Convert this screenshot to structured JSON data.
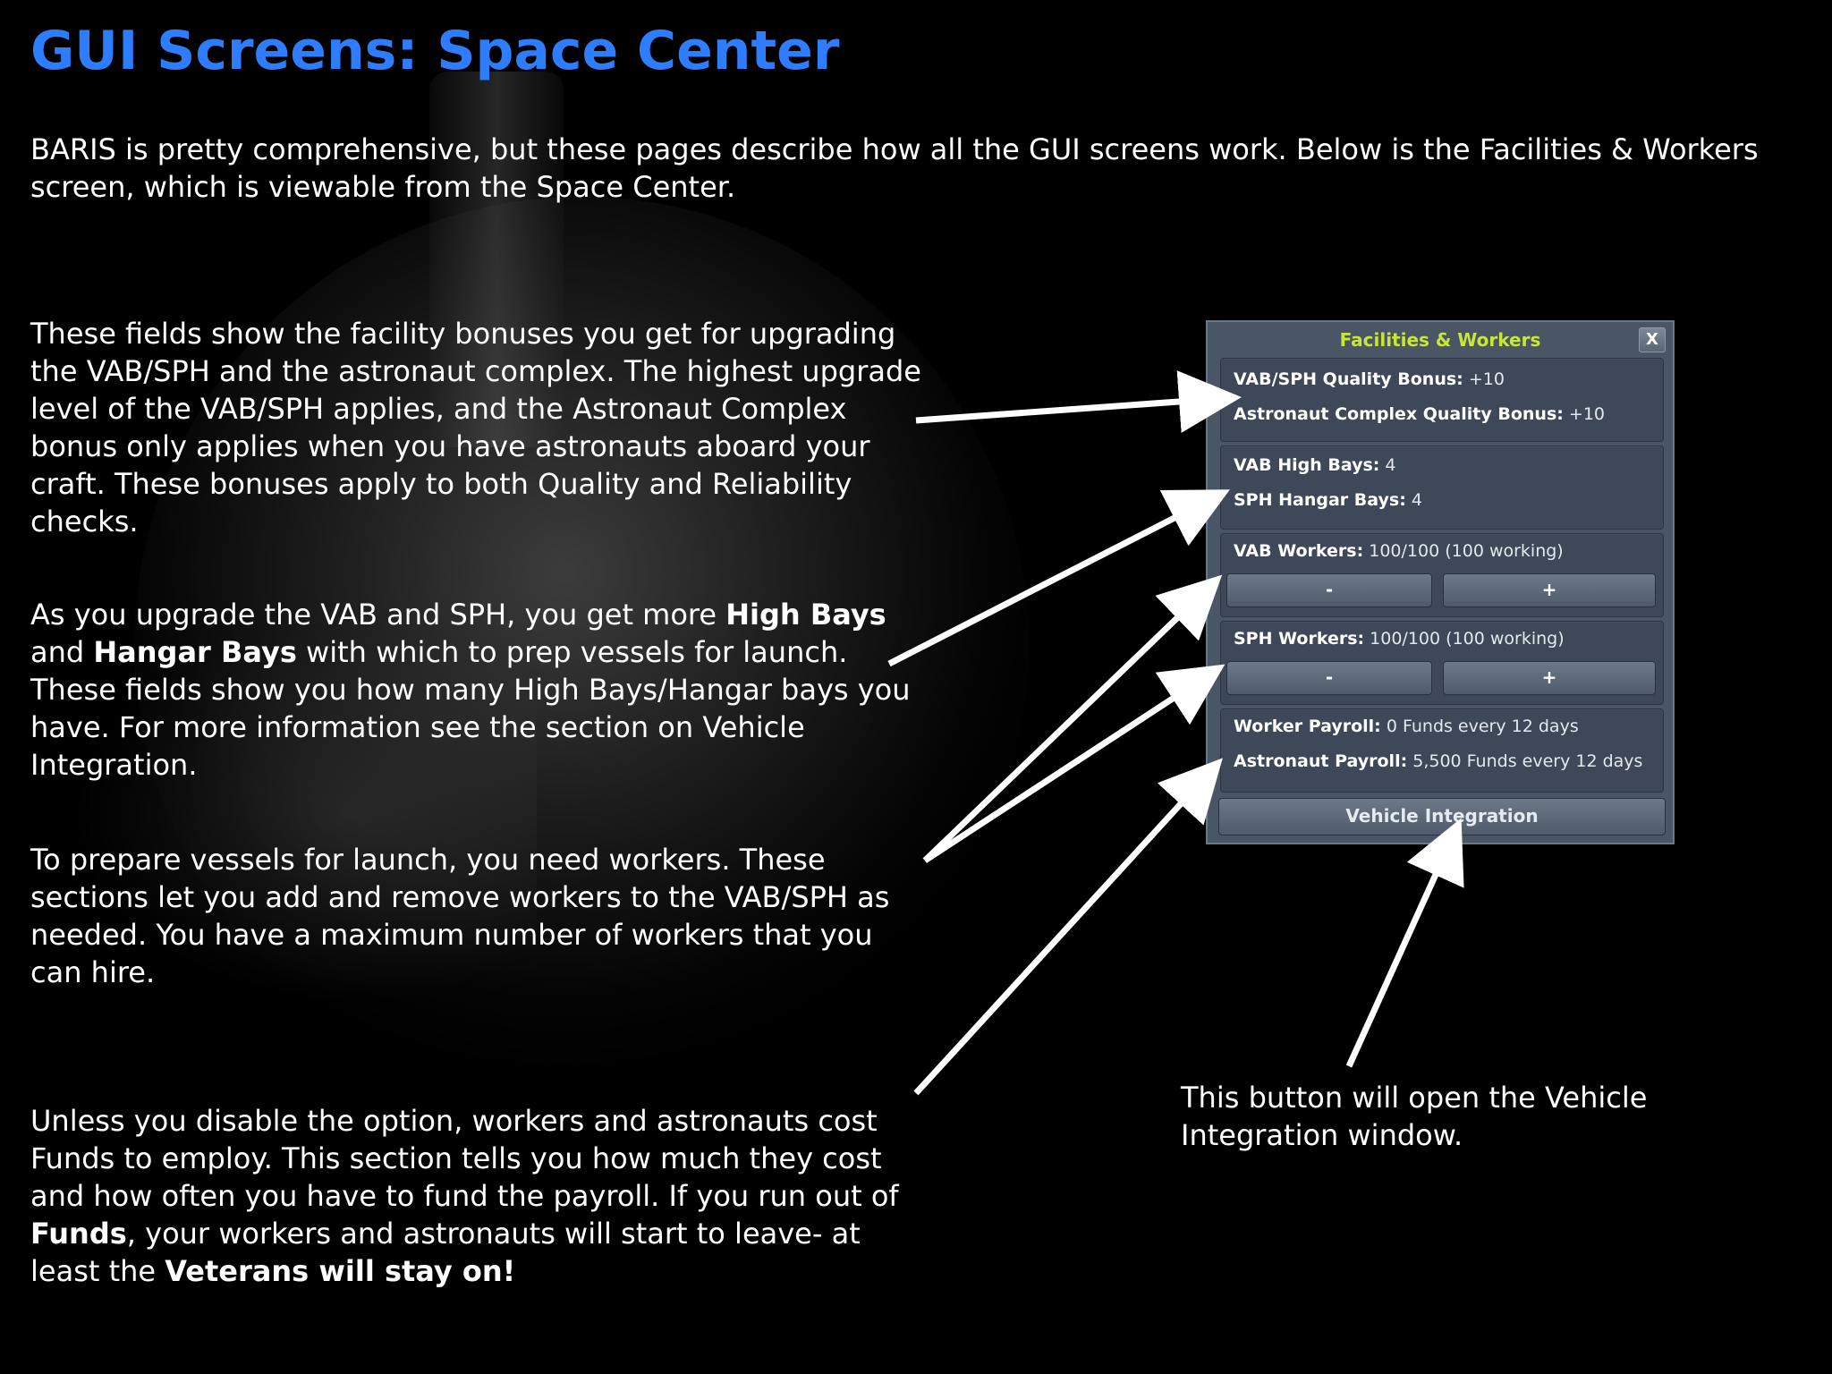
{
  "title": "GUI Screens: Space Center",
  "intro": "BARIS is pretty comprehensive, but these pages describe how all the GUI screens work. Below is the Facilities & Workers screen, which is viewable from the Space Center.",
  "paragraphs": {
    "p1": "These fields show the facility bonuses you get for upgrading the VAB/SPH and the astronaut complex. The highest upgrade level of the VAB/SPH applies, and the Astronaut Complex bonus only applies when you have astronauts aboard your craft. These bonuses apply to both Quality and Reliability checks.",
    "p2_a": "As you upgrade the VAB and SPH, you get more ",
    "p2_b": "High Bays",
    "p2_c": " and ",
    "p2_d": "Hangar Bays",
    "p2_e": " with which to prep vessels for launch. These fields show you how many High Bays/Hangar bays you have. For more information see the section on Vehicle Integration.",
    "p3": "To prepare vessels for launch, you need workers. These sections let you add and remove workers to the VAB/SPH as needed. You have a maximum number of workers that you can hire.",
    "p4_a": "Unless you disable the option, workers and astronauts cost Funds to employ. This section tells you how much they cost and how often you have to fund the payroll. If you run out of ",
    "p4_b": "Funds",
    "p4_c": ", your workers and astronauts will start to leave- at least the ",
    "p4_d": "Veterans will stay on!",
    "p5": "This button will open the Vehicle Integration window."
  },
  "window": {
    "title": "Facilities & Workers",
    "close_label": "X",
    "quality": {
      "vab_label": "VAB/SPH Quality Bonus:",
      "vab_value": " +10",
      "astro_label": "Astronaut Complex Quality Bonus:",
      "astro_value": " +10"
    },
    "bays": {
      "high_label": "VAB High Bays:",
      "high_value": " 4",
      "hangar_label": "SPH Hangar Bays:",
      "hangar_value": " 4"
    },
    "vab_workers": {
      "label": "VAB Workers:",
      "value": " 100/100 (100 working)",
      "minus": "-",
      "plus": "+"
    },
    "sph_workers": {
      "label": "SPH Workers:",
      "value": " 100/100 (100 working)",
      "minus": "-",
      "plus": "+"
    },
    "payroll": {
      "worker_label": "Worker Payroll:",
      "worker_value": " 0 Funds every 12 days",
      "astro_label": "Astronaut Payroll:",
      "astro_value": " 5,500 Funds every 12 days"
    },
    "vehicle_integration_label": "Vehicle Integration"
  },
  "colors": {
    "title": "#2f7dff",
    "window_title": "#c8e63a",
    "window_bg": "#4a5566"
  }
}
